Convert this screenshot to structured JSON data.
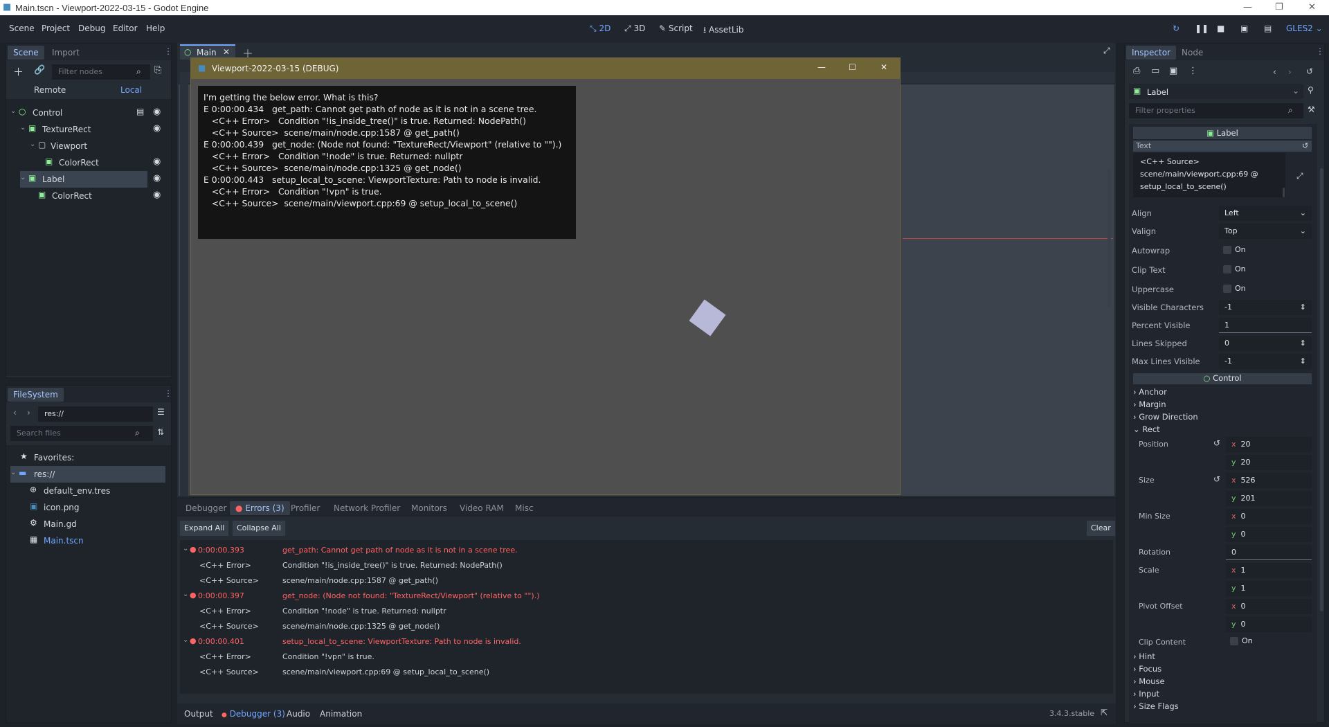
{
  "window": {
    "title": "Main.tscn - Viewport-2022-03-15 - Godot Engine"
  },
  "menu": [
    "Scene",
    "Project",
    "Debug",
    "Editor",
    "Help"
  ],
  "workspaces": [
    "2D",
    "3D",
    "Script",
    "AssetLib"
  ],
  "renderer": "GLES2",
  "scene_dock": {
    "tabs": [
      "Scene",
      "Import"
    ],
    "filter_placeholder": "Filter nodes",
    "remote": "Remote",
    "local": "Local",
    "tree": [
      {
        "name": "Control",
        "icon": "control-icon"
      },
      {
        "name": "TextureRect",
        "icon": "texturerect-icon"
      },
      {
        "name": "Viewport",
        "icon": "viewport-icon"
      },
      {
        "name": "ColorRect",
        "icon": "colorrect-icon"
      },
      {
        "name": "Label",
        "icon": "label-icon"
      },
      {
        "name": "ColorRect",
        "icon": "colorrect-icon"
      }
    ]
  },
  "filesystem": {
    "tab": "FileSystem",
    "path": "res://",
    "search_placeholder": "Search files",
    "favorites": "Favorites:",
    "root": "res://",
    "files": [
      "default_env.tres",
      "icon.png",
      "Main.gd",
      "Main.tscn"
    ]
  },
  "editor_tab": "Main",
  "debug_window": {
    "title": "Viewport-2022-03-15 (DEBUG)",
    "lines": [
      "I'm getting the below error. What is this?",
      "",
      "E 0:00:00.434   get_path: Cannot get path of node as it is not in a scene tree.",
      "   <C++ Error>   Condition \"!is_inside_tree()\" is true. Returned: NodePath()",
      "   <C++ Source>  scene/main/node.cpp:1587 @ get_path()",
      "E 0:00:00.439   get_node: (Node not found: \"TextureRect/Viewport\" (relative to \"\").)",
      "   <C++ Error>   Condition \"!node\" is true. Returned: nullptr",
      "   <C++ Source>  scene/main/node.cpp:1325 @ get_node()",
      "E 0:00:00.443   setup_local_to_scene: ViewportTexture: Path to node is invalid.",
      "   <C++ Error>   Condition \"!vpn\" is true.",
      "   <C++ Source>  scene/main/viewport.cpp:69 @ setup_local_to_scene()"
    ]
  },
  "debugger": {
    "tabs": [
      "Debugger",
      "Errors (3)",
      "Profiler",
      "Network Profiler",
      "Monitors",
      "Video RAM",
      "Misc"
    ],
    "expand_all": "Expand All",
    "collapse_all": "Collapse All",
    "clear": "Clear",
    "errors": [
      {
        "time": "0:00:00.393",
        "msg": "get_path: Cannot get path of node as it is not in a scene tree.",
        "error_label": "<C++ Error>",
        "error": "Condition \"!is_inside_tree()\" is true. Returned: NodePath()",
        "source_label": "<C++ Source>",
        "source": "scene/main/node.cpp:1587 @ get_path()"
      },
      {
        "time": "0:00:00.397",
        "msg": "get_node: (Node not found: \"TextureRect/Viewport\" (relative to \"\").)",
        "error_label": "<C++ Error>",
        "error": "Condition \"!node\" is true. Returned: nullptr",
        "source_label": "<C++ Source>",
        "source": "scene/main/node.cpp:1325 @ get_node()"
      },
      {
        "time": "0:00:00.401",
        "msg": "setup_local_to_scene: ViewportTexture: Path to node is invalid.",
        "error_label": "<C++ Error>",
        "error": "Condition \"!vpn\" is true.",
        "source_label": "<C++ Source>",
        "source": "scene/main/viewport.cpp:69 @ setup_local_to_scene()"
      }
    ]
  },
  "bottom_bar": {
    "tabs": [
      "Output",
      "Debugger (3)",
      "Audio",
      "Animation"
    ],
    "version": "3.4.3.stable"
  },
  "inspector": {
    "tabs": [
      "Inspector",
      "Node"
    ],
    "node": "Label",
    "filter_placeholder": "Filter properties",
    "class_header": "Label",
    "text_label": "Text",
    "text_value": [
      "<C++ Source>",
      "scene/main/viewport.cpp:69 @",
      "setup_local_to_scene()"
    ],
    "props": [
      {
        "name": "Align",
        "value": "Left"
      },
      {
        "name": "Valign",
        "value": "Top"
      },
      {
        "name": "Autowrap",
        "value": "On"
      },
      {
        "name": "Clip Text",
        "value": "On"
      },
      {
        "name": "Uppercase",
        "value": "On"
      },
      {
        "name": "Visible Characters",
        "value": "-1"
      },
      {
        "name": "Percent Visible",
        "value": "1"
      },
      {
        "name": "Lines Skipped",
        "value": "0"
      },
      {
        "name": "Max Lines Visible",
        "value": "-1"
      }
    ],
    "control_header": "Control",
    "sections": [
      "Anchor",
      "Margin",
      "Grow Direction",
      "Rect"
    ],
    "rect": {
      "position_label": "Position",
      "pos_x": "20",
      "pos_y": "20",
      "size_label": "Size",
      "size_x": "526",
      "size_y": "201",
      "min_size_label": "Min Size",
      "min_x": "0",
      "min_y": "0",
      "rotation_label": "Rotation",
      "rotation": "0",
      "scale_label": "Scale",
      "scale_x": "1",
      "scale_y": "1",
      "pivot_label": "Pivot Offset",
      "pivot_x": "0",
      "pivot_y": "0",
      "clip_label": "Clip Content",
      "clip_value": "On"
    },
    "more_sections": [
      "Hint",
      "Focus",
      "Mouse",
      "Input",
      "Size Flags"
    ]
  },
  "colors": {
    "accent": "#71a7ff",
    "error": "#ff6464",
    "debug_title": "#6f6435"
  }
}
